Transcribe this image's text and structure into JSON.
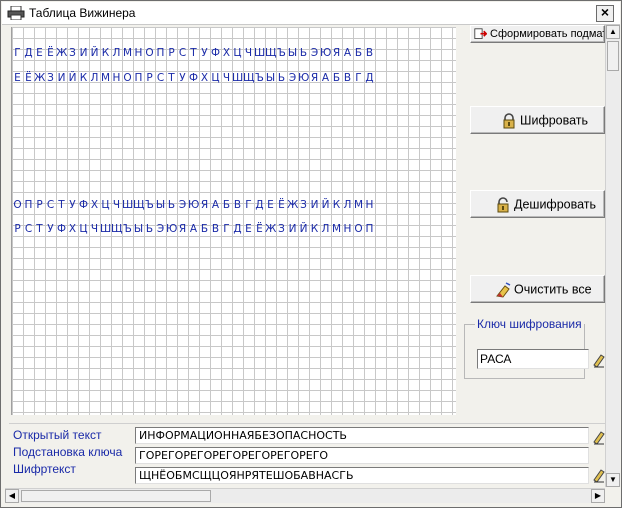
{
  "window": {
    "title": "Таблица Вижинера",
    "close_label": "×"
  },
  "grid": {
    "row1": [
      "Г",
      "Д",
      "Е",
      "Ё",
      "Ж",
      "З",
      "И",
      "Й",
      "К",
      "Л",
      "М",
      "Н",
      "О",
      "П",
      "Р",
      "С",
      "Т",
      "У",
      "Ф",
      "Х",
      "Ц",
      "Ч",
      "Ш",
      "Щ",
      "Ъ",
      "Ы",
      "Ь",
      "Э",
      "Ю",
      "Я",
      "А",
      "Б",
      "В"
    ],
    "row2": [
      "Е",
      "Ё",
      "Ж",
      "З",
      "И",
      "Й",
      "К",
      "Л",
      "М",
      "Н",
      "О",
      "П",
      "Р",
      "С",
      "Т",
      "У",
      "Ф",
      "Х",
      "Ц",
      "Ч",
      "Ш",
      "Щ",
      "Ъ",
      "Ы",
      "Ь",
      "Э",
      "Ю",
      "Я",
      "А",
      "Б",
      "В",
      "Г",
      "Д"
    ],
    "row3": [
      "О",
      "П",
      "Р",
      "С",
      "Т",
      "У",
      "Ф",
      "Х",
      "Ц",
      "Ч",
      "Ш",
      "Щ",
      "Ъ",
      "Ы",
      "Ь",
      "Э",
      "Ю",
      "Я",
      "А",
      "Б",
      "В",
      "Г",
      "Д",
      "Е",
      "Ё",
      "Ж",
      "З",
      "И",
      "Й",
      "К",
      "Л",
      "М",
      "Н"
    ],
    "row4": [
      "Р",
      "С",
      "Т",
      "У",
      "Ф",
      "Х",
      "Ц",
      "Ч",
      "Ш",
      "Щ",
      "Ъ",
      "Ы",
      "Ь",
      "Э",
      "Ю",
      "Я",
      "А",
      "Б",
      "В",
      "Г",
      "Д",
      "Е",
      "Ё",
      "Ж",
      "З",
      "И",
      "Й",
      "К",
      "Л",
      "М",
      "Н",
      "О",
      "П"
    ]
  },
  "buttons": {
    "form_submatrix": "Сформировать подматрицу",
    "encrypt": "Шифровать",
    "decrypt": "Дешифровать",
    "clear_all": "Очистить все"
  },
  "key": {
    "legend": "Ключ шифрования",
    "value": "РАСА"
  },
  "form": {
    "open_text_label": "Открытый текст",
    "key_sub_label": "Подстановка ключа",
    "cipher_label": "Шифртекст",
    "open_text_value": "ИНФОРМАЦИОННАЯБЕЗОПАСНОСТЬ",
    "key_sub_value": "ГОРЕГОРЕГОРЕГОРЕГОРЕГОРЕГО",
    "cipher_value": "ЩНЁОБМСЩЦОЯНРЯТЕШОБАВНАСГЬ"
  },
  "colors": {
    "label_blue": "#1a2aa8",
    "grid_line": "#c8c8c8"
  },
  "icons": [
    "printer-icon",
    "submatrix-icon",
    "lock-icon",
    "unlock-icon",
    "eraser-icon"
  ]
}
